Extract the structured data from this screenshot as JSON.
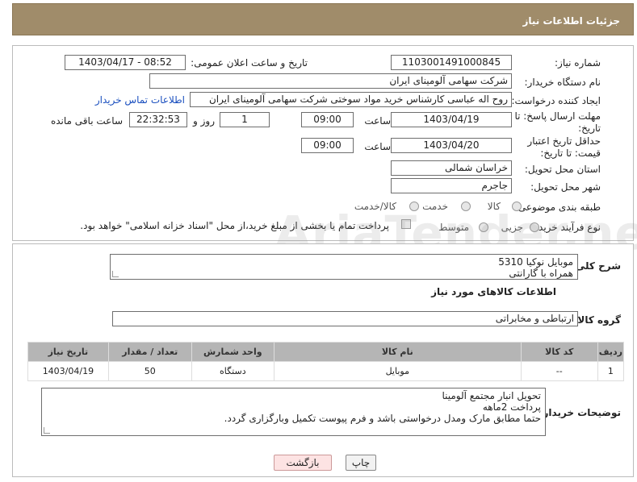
{
  "header": {
    "title": "جزئیات اطلاعات نیاز"
  },
  "need_number": {
    "label": "شماره نیاز:",
    "value": "1103001491000845"
  },
  "announce_datetime": {
    "label": "تاریخ و ساعت اعلان عمومی:",
    "value": "1403/04/17 - 08:52"
  },
  "buyer_org": {
    "label": "نام دستگاه خریدار:",
    "value": "شرکت سهامی آلومینای ایران"
  },
  "requester": {
    "label": "ایجاد کننده درخواست:",
    "value": "روح اله عباسی کارشناس خرید مواد سوختی شرکت سهامی آلومینای ایران",
    "contact_link": "اطلاعات تماس خریدار"
  },
  "reply_deadline": {
    "label": "مهلت ارسال پاسخ: تا تاریخ:",
    "date": "1403/04/19",
    "time_label": "ساعت",
    "time": "09:00",
    "days": "1",
    "days_label": "روز و",
    "remaining": "22:32:53",
    "remaining_label": "ساعت باقی مانده"
  },
  "price_validity": {
    "label": "حداقل تاریخ اعتبار قیمت: تا تاریخ:",
    "date": "1403/04/20",
    "time_label": "ساعت",
    "time": "09:00"
  },
  "province": {
    "label": "استان محل تحویل:",
    "value": "خراسان شمالی"
  },
  "city": {
    "label": "شهر محل تحویل:",
    "value": "جاجرم"
  },
  "category": {
    "label": "طبقه بندی موضوعی:",
    "options": [
      "کالا",
      "خدمت",
      "کالا/خدمت"
    ],
    "selected": "کالا"
  },
  "purchase_type": {
    "label": "نوع فرآیند خرید :",
    "options": [
      "جزیی",
      "متوسط"
    ],
    "payment_note": "پرداخت تمام یا بخشی از مبلغ خرید،از محل \"اسناد خزانه اسلامی\" خواهد بود."
  },
  "summary": {
    "label": "شرح کلی نیاز:",
    "value": "موبایل نوکیا 5310\nهمراه با گارانتی"
  },
  "goods_info": {
    "title": "اطلاعات کالاهای مورد نیاز"
  },
  "goods_group": {
    "label": "گروه کالا:",
    "value": "ارتباطی و مخابراتی"
  },
  "table": {
    "headers": [
      "ردیف",
      "کد کالا",
      "نام کالا",
      "واحد شمارش",
      "تعداد / مقدار",
      "تاریخ نیاز"
    ],
    "rows": [
      [
        "1",
        "--",
        "موبایل",
        "دستگاه",
        "50",
        "1403/04/19"
      ]
    ]
  },
  "buyer_notes": {
    "label": "توضیحات خریدار:",
    "value": "تحویل انبار مجتمع آلومینا\nپرداخت 2ماهه\nحتما مطابق مارک ومدل درخواستی باشد و فرم پیوست تکمیل وبارگزاری گردد."
  },
  "buttons": {
    "print": "چاپ",
    "back": "بازگشت"
  },
  "watermark": "AriaTender.neT",
  "colors": {
    "header_bg": "#a08c6a",
    "table_header_bg": "#b5b5b5",
    "link": "#1a4fbf",
    "back_button_bg": "#fde3e3"
  }
}
